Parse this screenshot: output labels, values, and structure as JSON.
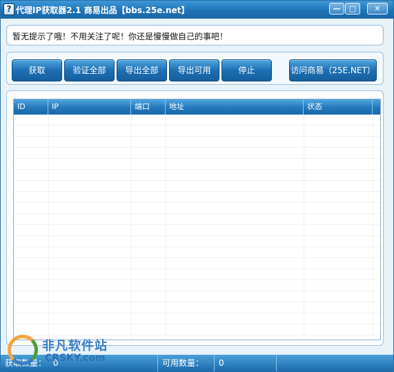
{
  "window": {
    "title": "代理IP获取器2.1 商易出品【bbs.25e.net】",
    "icon": "app-icon",
    "controls": {
      "minimize": "—",
      "maximize": "□",
      "close": "✕"
    }
  },
  "notice": {
    "text": "暂无提示了哦！不用关注了呢！你还是慢慢做自己的事吧！"
  },
  "toolbar": {
    "fetch": "获取",
    "verify_all": "验证全部",
    "export_all": "导出全部",
    "export_usable": "导出可用",
    "stop": "停止",
    "visit": "访问商易（25E.NET）"
  },
  "list": {
    "columns": [
      "ID",
      "IP",
      "端口",
      "地址",
      "状态"
    ],
    "rows": []
  },
  "status": {
    "fetched_label": "获取数量：",
    "fetched_value": "0",
    "usable_label": "可用数量：",
    "usable_value": "0"
  },
  "watermark": {
    "text_cn": "非凡软件站",
    "text_en": "CRSKY.com"
  },
  "colors": {
    "accent": "#1f74b8",
    "button_top": "#4fa6df",
    "button_bottom": "#155f9e",
    "panel_border": "#9fc2df"
  }
}
